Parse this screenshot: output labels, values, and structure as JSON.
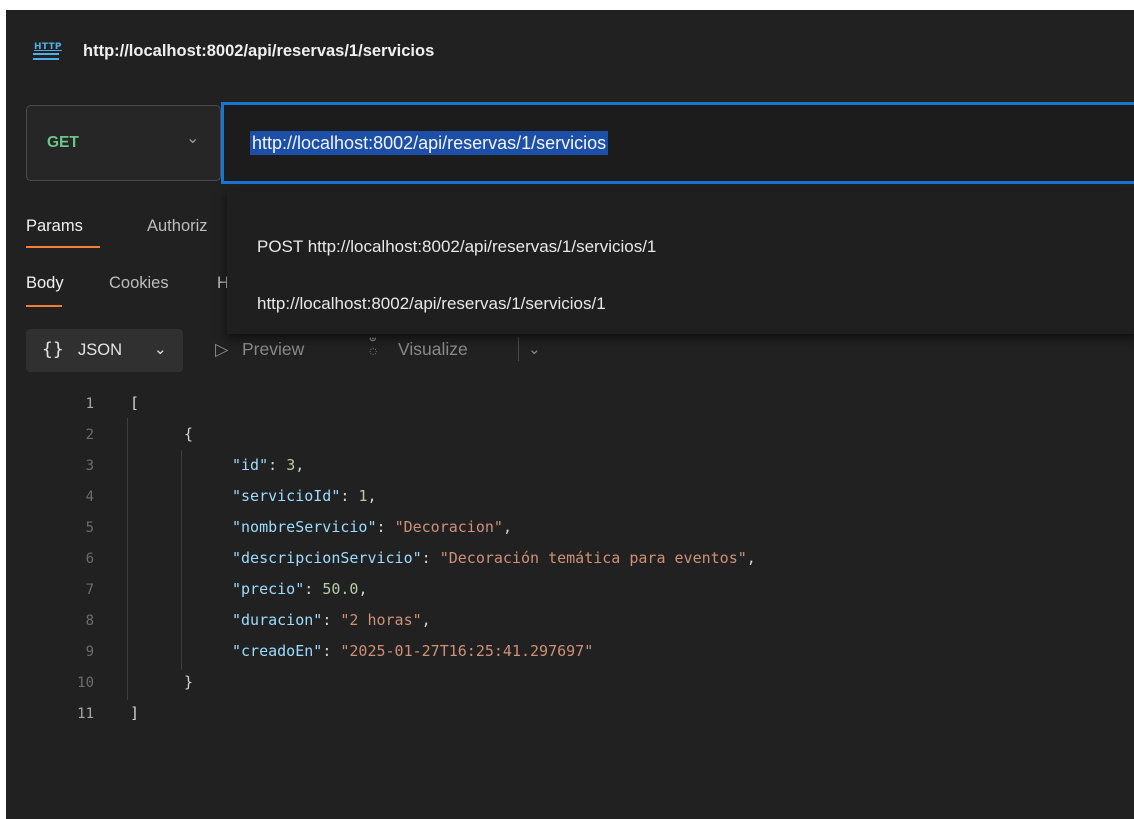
{
  "titlebar": {
    "icon_text": "HTTP",
    "icon": "http-request-icon",
    "title": "http://localhost:8002/api/reservas/1/servicios"
  },
  "request": {
    "method": "GET",
    "url": "http://localhost:8002/api/reservas/1/servicios"
  },
  "request_tabs": [
    {
      "label": "Params",
      "active": true
    },
    {
      "label": "Authoriz",
      "active": false
    }
  ],
  "response_tabs": [
    {
      "label": "Body",
      "active": true
    },
    {
      "label": "Cookies",
      "active": false
    },
    {
      "label": "H",
      "active": false
    }
  ],
  "suggestions": [
    "POST http://localhost:8002/api/reservas/1/servicios/1",
    "http://localhost:8002/api/reservas/1/servicios/1"
  ],
  "body_toolbar": {
    "format_braces": "{}",
    "format": "JSON",
    "preview": "Preview",
    "visualize": "Visualize"
  },
  "response_json": {
    "line_numbers": [
      "1",
      "2",
      "3",
      "4",
      "5",
      "6",
      "7",
      "8",
      "9",
      "10",
      "11"
    ],
    "open_bracket": "[",
    "open_brace": "{",
    "close_brace": "}",
    "close_bracket": "]",
    "fields": [
      {
        "key": "\"id\"",
        "value": "3",
        "type": "number",
        "comma": ","
      },
      {
        "key": "\"servicioId\"",
        "value": "1",
        "type": "number",
        "comma": ","
      },
      {
        "key": "\"nombreServicio\"",
        "value": "\"Decoracion\"",
        "type": "string",
        "comma": ","
      },
      {
        "key": "\"descripcionServicio\"",
        "value": "\"Decoración temática para eventos\"",
        "type": "string",
        "comma": ","
      },
      {
        "key": "\"precio\"",
        "value": "50.0",
        "type": "number",
        "comma": ","
      },
      {
        "key": "\"duracion\"",
        "value": "\"2 horas\"",
        "type": "string",
        "comma": ","
      },
      {
        "key": "\"creadoEn\"",
        "value": "\"2025-01-27T16:25:41.297697\"",
        "type": "string",
        "comma": ""
      }
    ]
  },
  "colors": {
    "method_get": "#6cc68a",
    "focus_border": "#1a74d0",
    "tab_underline": "#f07f3a",
    "json_key": "#9cdcfe",
    "json_string": "#ce9178",
    "json_number": "#b5cea8"
  }
}
